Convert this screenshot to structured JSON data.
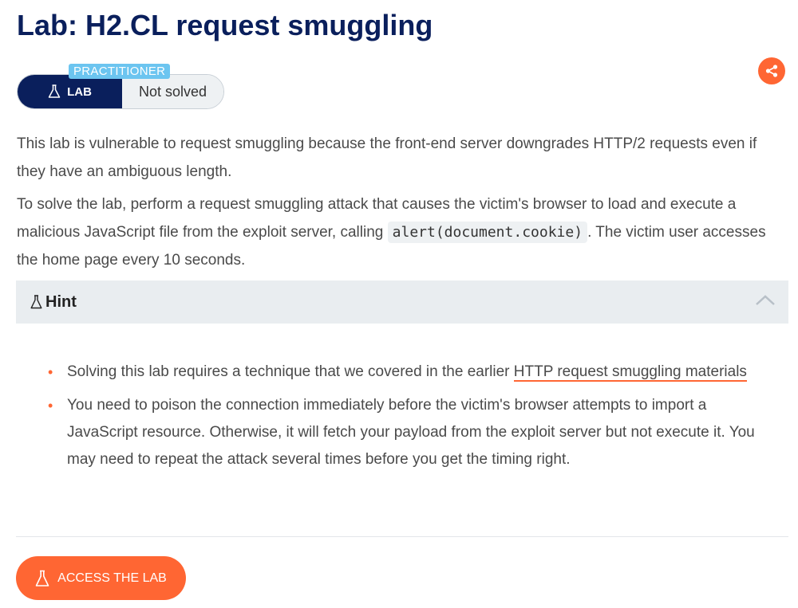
{
  "title": "Lab: H2.CL request smuggling",
  "badge": {
    "level": "PRACTITIONER",
    "lab_label": "LAB",
    "status": "Not solved"
  },
  "description": {
    "p1": "This lab is vulnerable to request smuggling because the front-end server downgrades HTTP/2 requests even if they have an ambiguous length.",
    "p2_before": "To solve the lab, perform a request smuggling attack that causes the victim's browser to load and execute a malicious JavaScript file from the exploit server, calling ",
    "p2_code": "alert(document.cookie)",
    "p2_after": ". The victim user accesses the home page every 10 seconds."
  },
  "hint": {
    "label": "Hint",
    "items": [
      {
        "text": "Solving this lab requires a technique that we covered in the earlier ",
        "link": "HTTP request smuggling materials"
      },
      {
        "text": "You need to poison the connection immediately before the victim's browser attempts to import a JavaScript resource. Otherwise, it will fetch your payload from the exploit server but not execute it. You may need to repeat the attack several times before you get the timing right."
      }
    ]
  },
  "cta": {
    "label": "ACCESS THE LAB"
  },
  "colors": {
    "accent": "#ff6633",
    "navy": "#0a1f5c",
    "level": "#6cc5f0"
  },
  "icons": {
    "share": "share-icon",
    "flask": "flask-icon",
    "chevron": "chevron-up-icon"
  }
}
